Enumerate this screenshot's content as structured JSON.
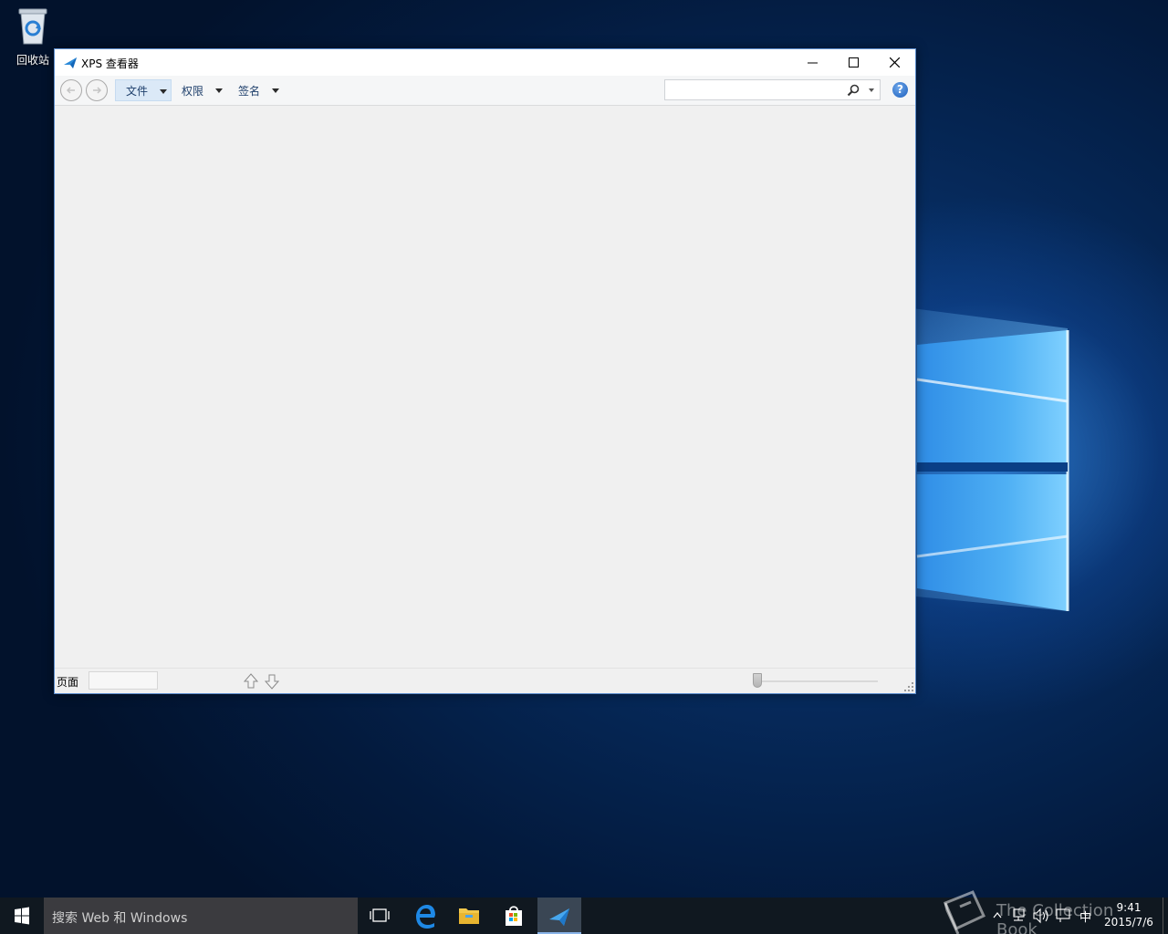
{
  "desktop": {
    "recycle_bin_label": "回收站"
  },
  "window": {
    "title": "XPS 查看器",
    "caption_buttons": {
      "minimize": "—",
      "maximize": "☐",
      "close": "✕"
    },
    "menus": {
      "file": "文件",
      "permissions": "权限",
      "signatures": "签名"
    },
    "search": {
      "placeholder": "",
      "value": ""
    },
    "help_label": "?",
    "status": {
      "page_label": "页面",
      "page_value": ""
    }
  },
  "taskbar": {
    "search_placeholder": "搜索 Web 和 Windows",
    "pinned": [
      "task-view",
      "edge",
      "file-explorer",
      "store",
      "xps-viewer"
    ],
    "tray": {
      "ime": "中"
    },
    "clock": {
      "time": "9:41",
      "date": "2015/7/6"
    }
  },
  "watermark": {
    "text": "The Collection Book"
  },
  "colors": {
    "accent": "#1e6fd6",
    "taskbar_bg": "#101820",
    "window_border": "#5b8ccc"
  }
}
